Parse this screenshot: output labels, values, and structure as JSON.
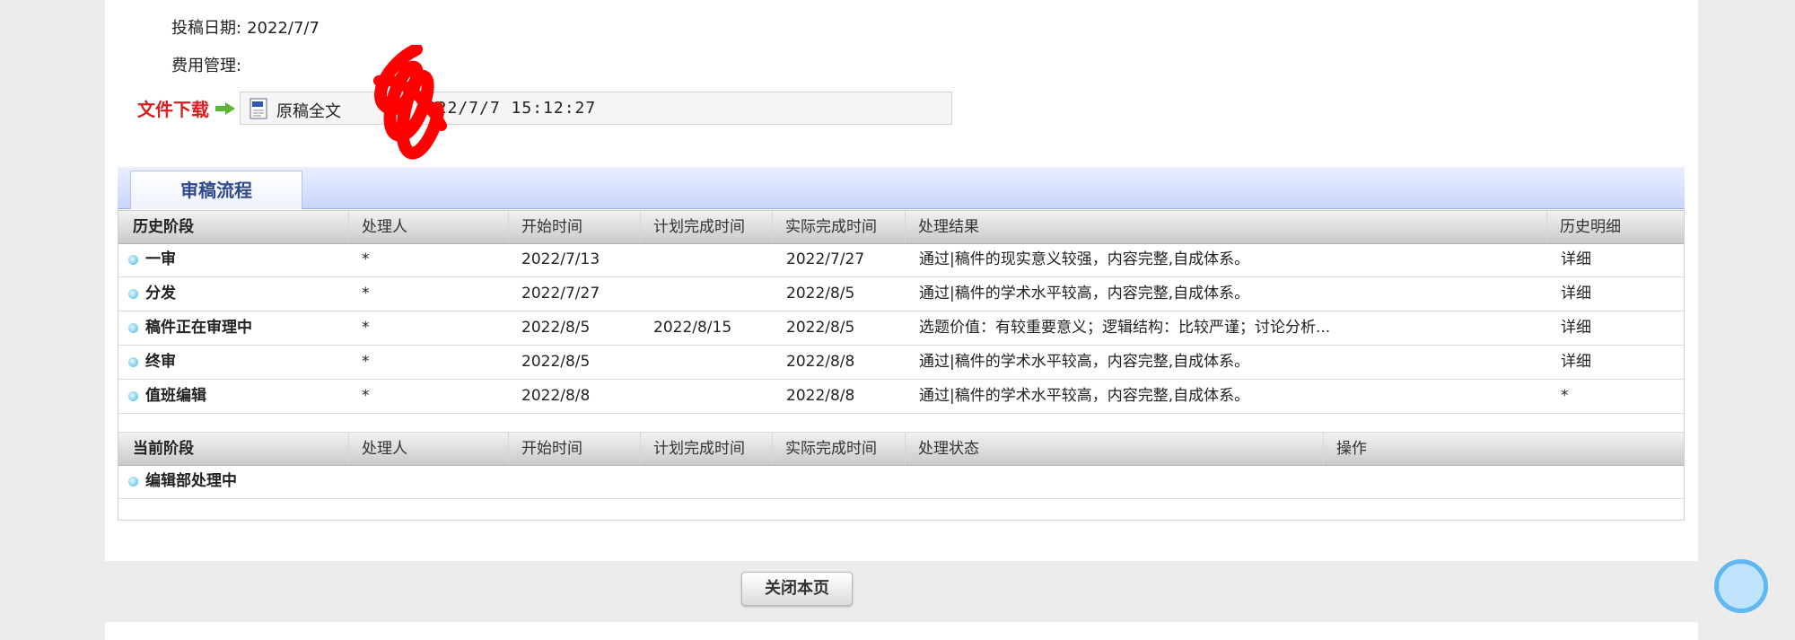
{
  "meta": {
    "submit_date_label": "投稿日期:",
    "submit_date_value": "2022/7/7",
    "fee_label": "费用管理:"
  },
  "download": {
    "label": "文件下载",
    "file_name": "原稿全文",
    "file_time": "2022/7/7 15:12:27"
  },
  "tab": {
    "label": "审稿流程"
  },
  "history": {
    "headers": [
      "历史阶段",
      "处理人",
      "开始时间",
      "计划完成时间",
      "实际完成时间",
      "处理结果",
      "历史明细"
    ],
    "rows": [
      {
        "stage": "一审",
        "handler": "*",
        "start": "2022/7/13",
        "planned": "",
        "actual": "2022/7/27",
        "result": "通过|稿件的现实意义较强，内容完整,自成体系。",
        "detail": "详细"
      },
      {
        "stage": "分发",
        "handler": "*",
        "start": "2022/7/27",
        "planned": "",
        "actual": "2022/8/5",
        "result": "通过|稿件的学术水平较高，内容完整,自成体系。",
        "detail": "详细"
      },
      {
        "stage": "稿件正在审理中",
        "handler": "*",
        "start": "2022/8/5",
        "planned": "2022/8/15",
        "actual": "2022/8/5",
        "result": "选题价值：有较重要意义；逻辑结构：比较严谨；讨论分析...",
        "detail": "详细"
      },
      {
        "stage": "终审",
        "handler": "*",
        "start": "2022/8/5",
        "planned": "",
        "actual": "2022/8/8",
        "result": "通过|稿件的学术水平较高，内容完整,自成体系。",
        "detail": "详细"
      },
      {
        "stage": "值班编辑",
        "handler": "*",
        "start": "2022/8/8",
        "planned": "",
        "actual": "2022/8/8",
        "result": "通过|稿件的学术水平较高，内容完整,自成体系。",
        "detail": "*"
      }
    ]
  },
  "current": {
    "headers": [
      "当前阶段",
      "处理人",
      "开始时间",
      "计划完成时间",
      "实际完成时间",
      "处理状态",
      "操作"
    ],
    "rows": [
      {
        "stage": "编辑部处理中"
      }
    ]
  },
  "close_button": "关闭本页"
}
